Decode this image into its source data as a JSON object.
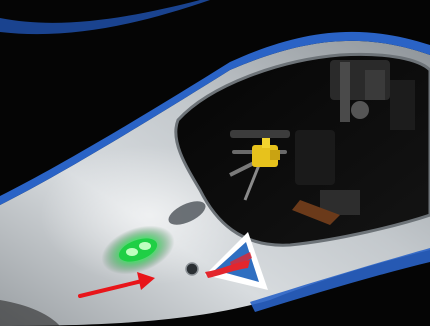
{
  "scene": {
    "subject": "device-close-up",
    "indicator_light_color": "#1fcf45",
    "body_color": "#c9cdd0",
    "trim_color": "#2a63c6",
    "annotation": {
      "type": "arrow",
      "color": "#e8151a",
      "points_to": "recessed-button"
    },
    "sticker_colors": [
      "#2f6fc1",
      "#e3262d",
      "#ffffff"
    ]
  }
}
